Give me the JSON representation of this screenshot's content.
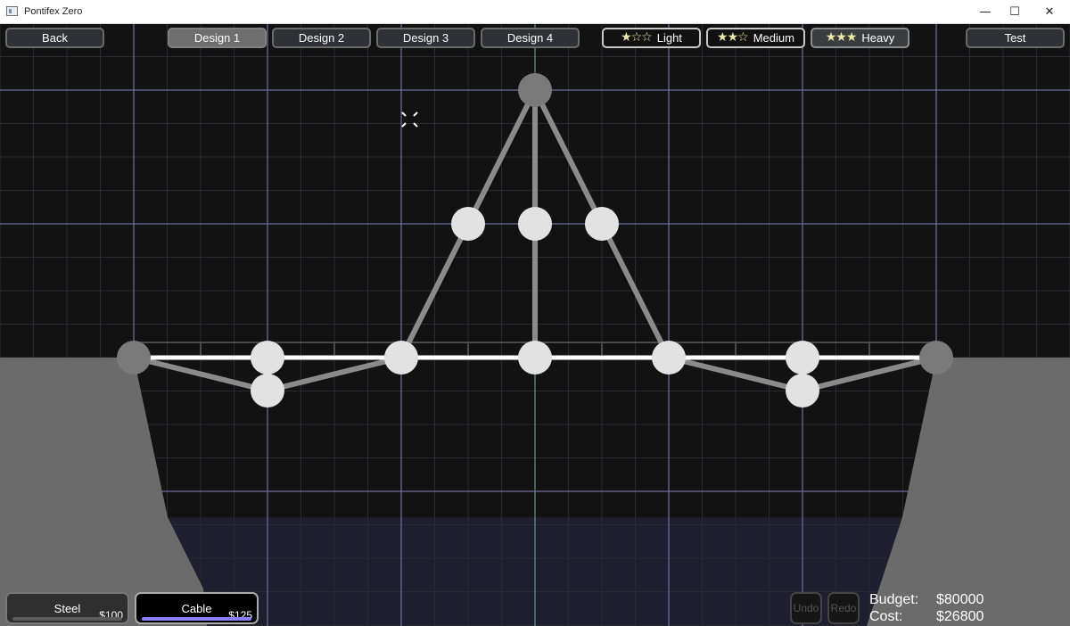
{
  "window": {
    "title": "Pontifex Zero",
    "controls": {
      "minimize": "—",
      "maximize": "☐",
      "close": "✕"
    }
  },
  "toolbar": {
    "back_label": "Back",
    "designs": [
      "Design 1",
      "Design 2",
      "Design 3",
      "Design 4"
    ],
    "active_design": 0,
    "difficulty": [
      {
        "label": "Light",
        "stars": "★☆☆"
      },
      {
        "label": "Medium",
        "stars": "★★☆"
      },
      {
        "label": "Heavy",
        "stars": "★★★"
      }
    ],
    "test_label": "Test"
  },
  "materials": [
    {
      "name": "Steel",
      "price": "$100",
      "bar_color": "#5a5a5a"
    },
    {
      "name": "Cable",
      "price": "$125",
      "bar_color": "#8a7dff"
    }
  ],
  "history": {
    "undo_label": "Undo",
    "redo_label": "Redo"
  },
  "budget": {
    "budget_label": "Budget:",
    "budget_value": "$80000",
    "cost_label": "Cost:",
    "cost_value": "$26800"
  },
  "colors": {
    "background": "#121212",
    "grid_minor": "#2b2b2f",
    "grid_major": "#6f6fa0",
    "ground": "#6b6b6b",
    "water": "#1e1e2e",
    "member": "#8a8a8a",
    "deck_cable": "#ffffff",
    "node": "#e2e2e2",
    "anchor": "#7a7a7a"
  }
}
